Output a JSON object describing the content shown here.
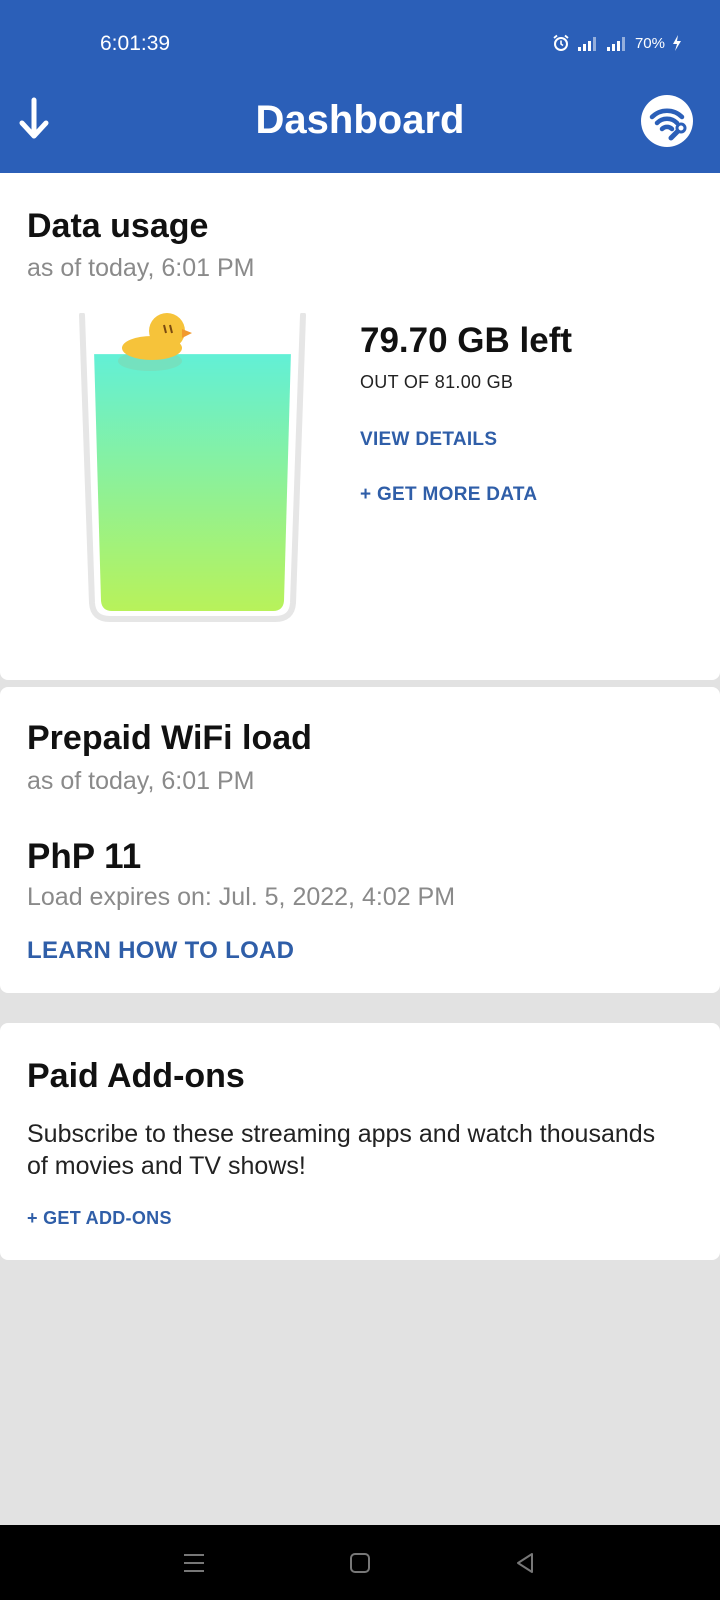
{
  "status_bar": {
    "time": "6:01:39",
    "battery": "70%"
  },
  "header": {
    "title": "Dashboard"
  },
  "data_usage": {
    "title": "Data usage",
    "as_of": "as of today, 6:01 PM",
    "remaining": "79.70 GB left",
    "total": "OUT OF 81.00 GB",
    "fill_fraction": 0.984,
    "view_details": "VIEW DETAILS",
    "get_more_data": "+ GET MORE DATA"
  },
  "prepaid": {
    "title": "Prepaid WiFi load",
    "as_of": "as of today, 6:01 PM",
    "amount": "PhP 11",
    "expiry": "Load expires on: Jul. 5, 2022, 4:02 PM",
    "learn_link": "LEARN HOW TO LOAD"
  },
  "addons": {
    "title": "Paid Add-ons",
    "description": "Subscribe to these streaming apps and watch thousands of movies and TV shows!",
    "get_addons": "+ GET ADD-ONS"
  },
  "colors": {
    "header": "#2b5fb8",
    "link": "#2f5ea8"
  }
}
